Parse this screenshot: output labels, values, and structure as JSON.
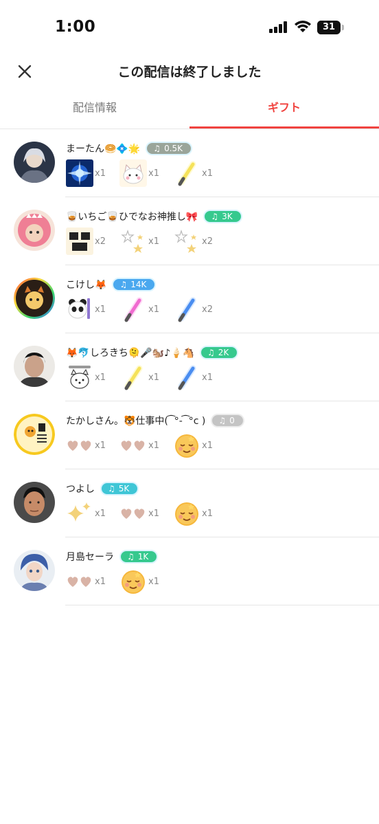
{
  "status_bar": {
    "time": "1:00",
    "battery": "31",
    "battery_percent": 31
  },
  "header": {
    "title": "この配信は終了しました",
    "close_icon": "close-icon"
  },
  "tabs": [
    {
      "label": "配信情報",
      "active": false
    },
    {
      "label": "ギフト",
      "active": true
    }
  ],
  "colors": {
    "accent": "#f0433f",
    "badge_gray": "#9aa59a",
    "badge_green": "#36c98e",
    "badge_blue": "#4aa8ef",
    "badge_teal": "#3fc6d6",
    "badge_silver": "#c4c4c4"
  },
  "gifters": [
    {
      "name": "まーたん🥯💠🌟",
      "badge": "0.5K",
      "badge_color": "#9aa59a",
      "avatar": "avatar-fantasy-character",
      "gifts": [
        {
          "icon": "blue-energy-burst-gift",
          "count": "x1"
        },
        {
          "icon": "cat-sticker-gift",
          "count": "x1"
        },
        {
          "icon": "yellow-glowstick-gift",
          "count": "x1"
        }
      ]
    },
    {
      "name": "🥃いちご🥃ひでなお神推し🎀",
      "badge": "3K",
      "badge_color": "#36c98e",
      "avatar": "avatar-pink-dino-hood",
      "gifts": [
        {
          "icon": "strongest-text-sticker-gift",
          "count": "x2"
        },
        {
          "icon": "stars-gift",
          "count": "x1"
        },
        {
          "icon": "stars-gift",
          "count": "x2"
        }
      ]
    },
    {
      "name": "こけし🦊",
      "badge": "14K",
      "badge_color": "#4aa8ef",
      "avatar": "avatar-illustrated-girl",
      "gifts": [
        {
          "icon": "panda-sticker-gift",
          "count": "x1"
        },
        {
          "icon": "pink-glowstick-gift",
          "count": "x1"
        },
        {
          "icon": "blue-glowstick-gift",
          "count": "x2"
        }
      ]
    },
    {
      "name": "🦊🐬しろきち🫠🎤🐿️♪🍦🐴",
      "badge": "2K",
      "badge_color": "#36c98e",
      "avatar": "avatar-photo-man",
      "gifts": [
        {
          "icon": "dog-sticker-gift",
          "count": "x1"
        },
        {
          "icon": "yellow-glowstick-gift",
          "count": "x1"
        },
        {
          "icon": "blue-glowstick-gift",
          "count": "x1"
        }
      ]
    },
    {
      "name": "たかしさん。🐯仕事中( ͡ °- ͡ °c )",
      "badge": "0",
      "badge_color": "#c4c4c4",
      "avatar": "avatar-yellow-logo",
      "gifts": [
        {
          "icon": "hearts-gift",
          "count": "x1"
        },
        {
          "icon": "hearts-gift",
          "count": "x1"
        },
        {
          "icon": "relieved-face-gift",
          "count": "x1"
        }
      ]
    },
    {
      "name": "つよし",
      "badge": "5K",
      "badge_color": "#3fc6d6",
      "avatar": "avatar-photo-face",
      "gifts": [
        {
          "icon": "sparkles-gift",
          "count": "x1"
        },
        {
          "icon": "hearts-gift",
          "count": "x1"
        },
        {
          "icon": "relieved-face-gift",
          "count": "x1"
        }
      ]
    },
    {
      "name": "月島セーラ",
      "badge": "1K",
      "badge_color": "#36c98e",
      "avatar": "avatar-doll",
      "gifts": [
        {
          "icon": "hearts-gift",
          "count": "x1"
        },
        {
          "icon": "relieved-face-gift",
          "count": "x1"
        }
      ]
    }
  ]
}
